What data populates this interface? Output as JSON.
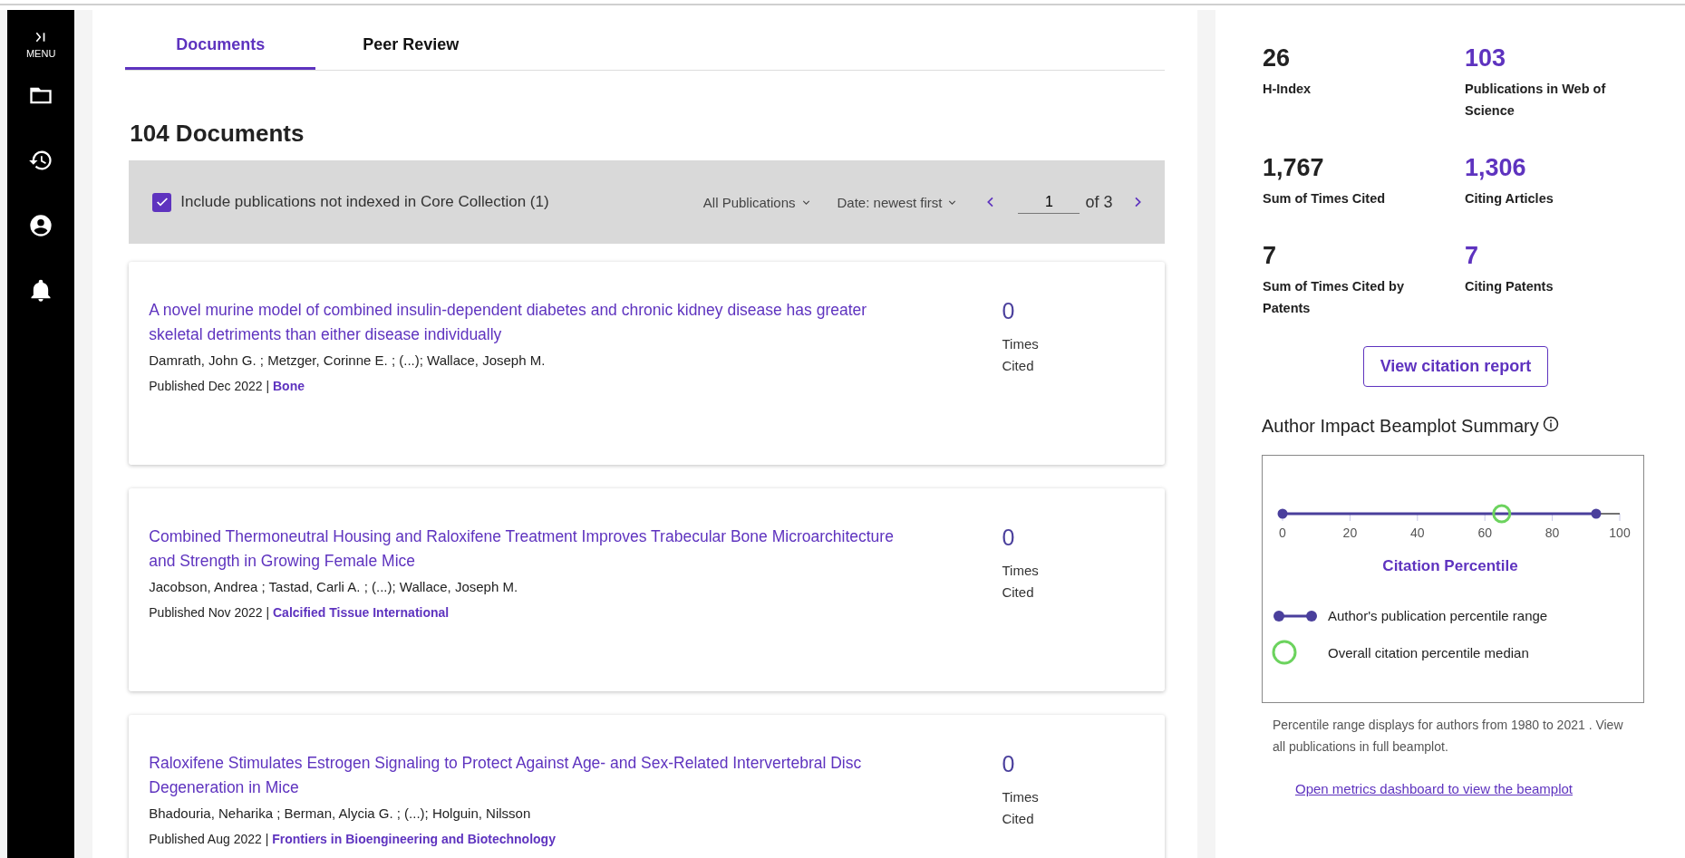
{
  "sidebar": {
    "menu_label": "MENU"
  },
  "tabs": [
    {
      "label": "Documents",
      "selected": true
    },
    {
      "label": "Peer Review",
      "selected": false
    }
  ],
  "heading": "104 Documents",
  "toolbar": {
    "include_checkbox": {
      "label": "Include publications not indexed in Core Collection (1)",
      "checked": true
    },
    "filter": "All Publications",
    "sort": "Date: newest first",
    "page": {
      "value": "1",
      "total": "of 3"
    }
  },
  "documents": [
    {
      "title": "A novel murine model of combined insulin-dependent diabetes and chronic kidney disease has greater skeletal detriments than either disease individually",
      "authors": "Damrath, John G. ; Metzger, Corinne E. ; (...); Wallace, Joseph M.",
      "published": "Published Dec 2022 |",
      "source": "Bone",
      "times_cited": "0",
      "times_cited_label": "Times Cited"
    },
    {
      "title": "Combined Thermoneutral Housing and Raloxifene Treatment Improves Trabecular Bone Microarchitecture and Strength in Growing Female Mice",
      "authors": "Jacobson, Andrea ; Tastad, Carli A. ; (...); Wallace, Joseph M.",
      "published": "Published Nov 2022 |",
      "source": "Calcified Tissue International",
      "times_cited": "0",
      "times_cited_label": "Times Cited"
    },
    {
      "title": "Raloxifene Stimulates Estrogen Signaling to Protect Against Age- and Sex-Related Intervertebral Disc Degeneration in Mice",
      "authors": "Bhadouria, Neharika ; Berman, Alycia G. ; (...); Holguin, Nilsson",
      "published": "Published Aug 2022 |",
      "source": "Frontiers in Bioengineering and Biotechnology",
      "times_cited": "0",
      "times_cited_label": "Times Cited"
    }
  ],
  "metrics": [
    {
      "value": "26",
      "label": "H-Index",
      "linked": false
    },
    {
      "value": "103",
      "label": "Publications in Web of Science",
      "linked": true
    },
    {
      "value": "1,767",
      "label": "Sum of Times Cited",
      "linked": false
    },
    {
      "value": "1,306",
      "label": "Citing Articles",
      "linked": true
    },
    {
      "value": "7",
      "label": "Sum of Times Cited by Patents",
      "linked": false
    },
    {
      "value": "7",
      "label": "Citing Patents",
      "linked": true
    }
  ],
  "citation_report_button": "View citation report",
  "beamplot": {
    "title": "Author Impact Beamplot Summary",
    "axis_ticks": [
      "0",
      "20",
      "40",
      "60",
      "80",
      "100"
    ],
    "axis_title": "Citation Percentile",
    "markers": [
      {
        "kind": "range",
        "label": "Author's publication percentile range",
        "color": "#4a3f9c",
        "level": 0.93
      },
      {
        "kind": "median",
        "label": "Overall citation percentile median",
        "color": "#6cd35e",
        "level": 0.65
      }
    ],
    "note": "Percentile range displays for authors from 1980 to 2021 . View all publications in full beamplot.",
    "link": "Open metrics dashboard to view the beamplot"
  }
}
